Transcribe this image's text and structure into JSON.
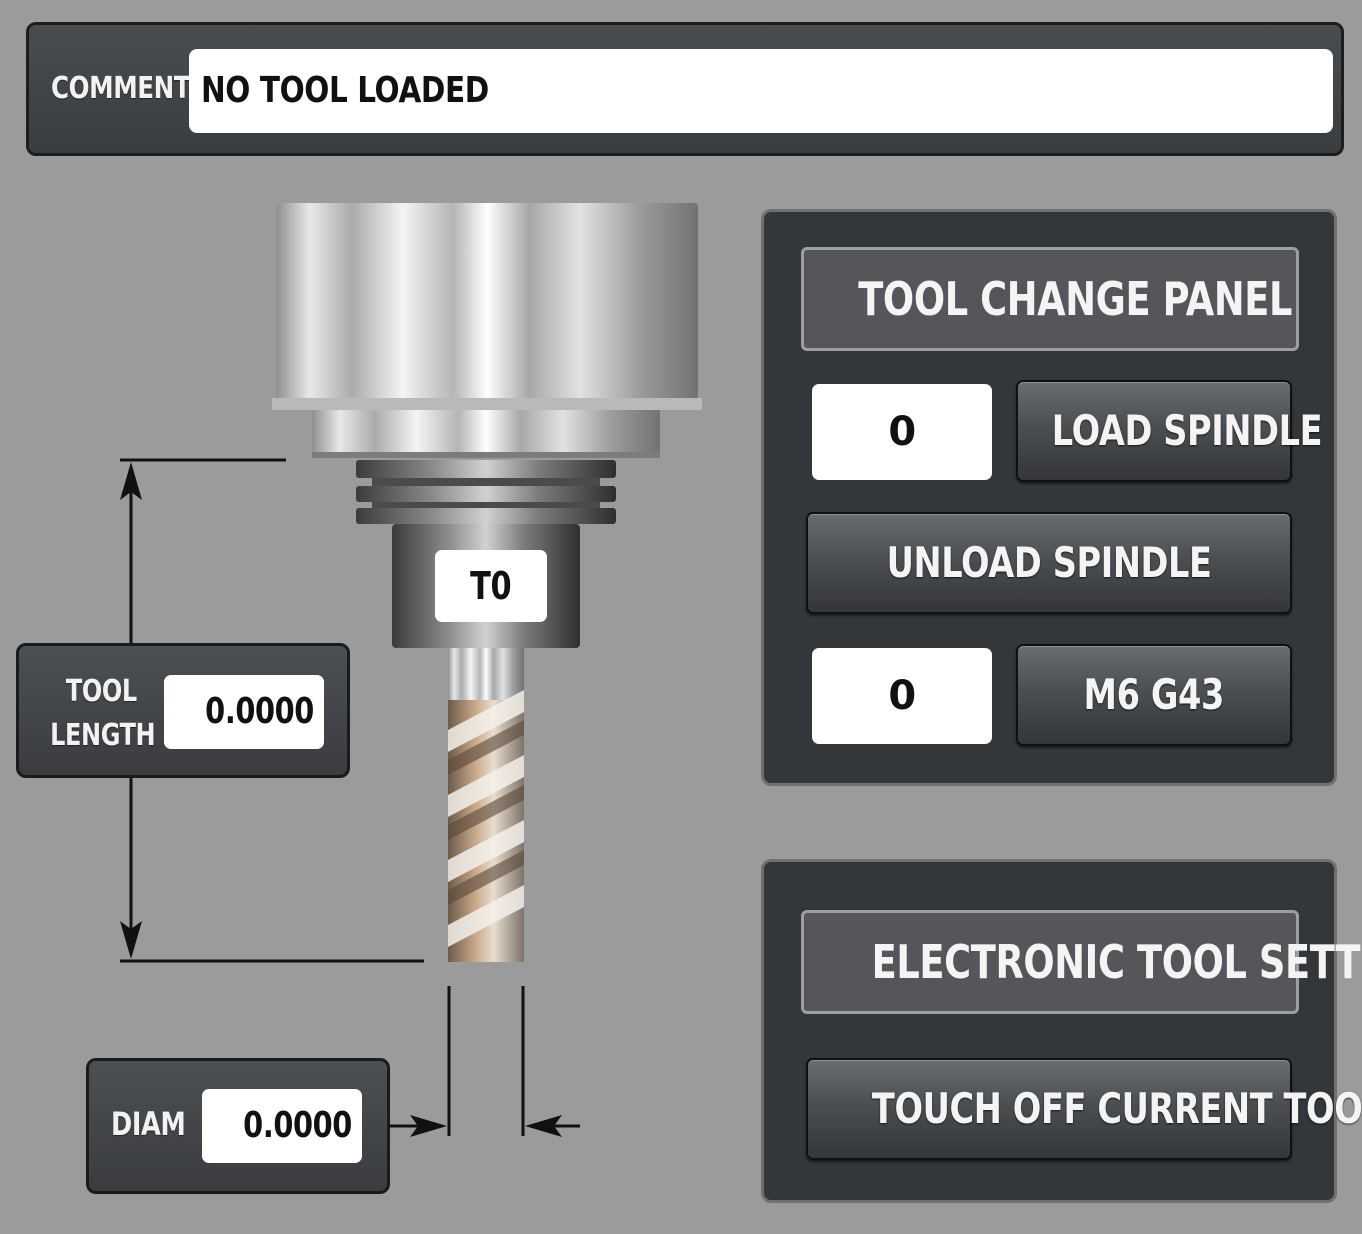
{
  "comment": {
    "label": "COMMENT",
    "value": "NO TOOL LOADED"
  },
  "tool": {
    "number_badge": "T0",
    "length": {
      "label_line1": "TOOL",
      "label_line2": "LENGTH",
      "value": "0.0000"
    },
    "diam": {
      "label": "DIAM",
      "value": "0.0000"
    }
  },
  "tool_change_panel": {
    "title": "TOOL CHANGE PANEL",
    "load_tool_number": "0",
    "load_button": "LOAD SPINDLE",
    "unload_button": "UNLOAD SPINDLE",
    "m6_tool_number": "0",
    "m6_button": "M6 G43"
  },
  "tool_setter_panel": {
    "title": "ELECTRONIC TOOL SETTER",
    "touch_off_button": "TOUCH OFF CURRENT TOOL"
  },
  "colors": {
    "background": "#9a9b9a",
    "panel": "#33373a",
    "field": "#ffffff"
  }
}
